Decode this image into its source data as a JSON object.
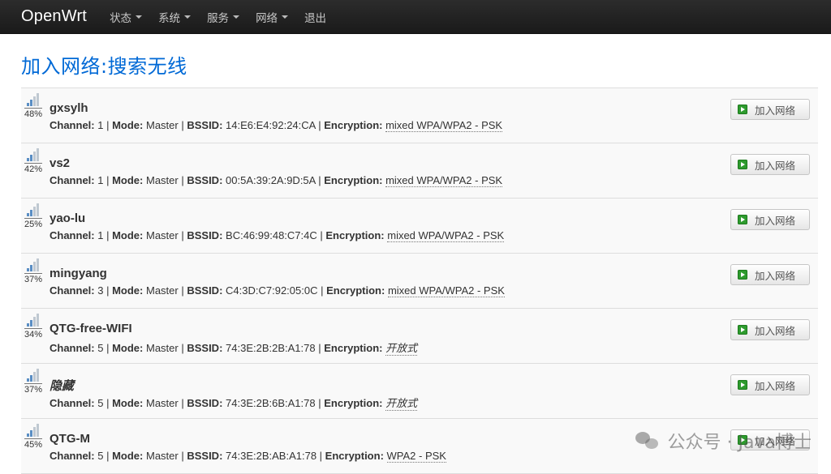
{
  "brand": "OpenWrt",
  "menu": [
    {
      "label": "状态",
      "dropdown": true
    },
    {
      "label": "系统",
      "dropdown": true
    },
    {
      "label": "服务",
      "dropdown": true
    },
    {
      "label": "网络",
      "dropdown": true
    },
    {
      "label": "退出",
      "dropdown": false
    }
  ],
  "page_title": "加入网络:搜索无线",
  "labels": {
    "channel": "Channel:",
    "mode": "Mode:",
    "bssid": "BSSID:",
    "encryption": "Encryption:",
    "join": "加入网络"
  },
  "networks": [
    {
      "ssid": "gxsylh",
      "signal": "48%",
      "signal_level": 0.48,
      "channel": "1",
      "mode": "Master",
      "bssid": "14:E6:E4:92:24:CA",
      "encryption": "mixed WPA/WPA2 - PSK",
      "hidden": false,
      "open": false
    },
    {
      "ssid": "vs2",
      "signal": "42%",
      "signal_level": 0.42,
      "channel": "1",
      "mode": "Master",
      "bssid": "00:5A:39:2A:9D:5A",
      "encryption": "mixed WPA/WPA2 - PSK",
      "hidden": false,
      "open": false
    },
    {
      "ssid": "yao-lu",
      "signal": "25%",
      "signal_level": 0.25,
      "channel": "1",
      "mode": "Master",
      "bssid": "BC:46:99:48:C7:4C",
      "encryption": "mixed WPA/WPA2 - PSK",
      "hidden": false,
      "open": false
    },
    {
      "ssid": "mingyang",
      "signal": "37%",
      "signal_level": 0.37,
      "channel": "3",
      "mode": "Master",
      "bssid": "C4:3D:C7:92:05:0C",
      "encryption": "mixed WPA/WPA2 - PSK",
      "hidden": false,
      "open": false
    },
    {
      "ssid": "QTG-free-WIFI",
      "signal": "34%",
      "signal_level": 0.34,
      "channel": "5",
      "mode": "Master",
      "bssid": "74:3E:2B:2B:A1:78",
      "encryption": "开放式",
      "hidden": false,
      "open": true
    },
    {
      "ssid": "隐藏",
      "signal": "37%",
      "signal_level": 0.37,
      "channel": "5",
      "mode": "Master",
      "bssid": "74:3E:2B:6B:A1:78",
      "encryption": "开放式",
      "hidden": true,
      "open": true
    },
    {
      "ssid": "QTG-M",
      "signal": "45%",
      "signal_level": 0.45,
      "channel": "5",
      "mode": "Master",
      "bssid": "74:3E:2B:AB:A1:78",
      "encryption": "WPA2 - PSK",
      "hidden": false,
      "open": false
    }
  ],
  "watermark": "公众号 · Java博士",
  "colors": {
    "navbar": "#1f1f1f",
    "title": "#0069d6",
    "join_icon": "#2e9b2e",
    "signal_bar": "#5a8ec4"
  }
}
